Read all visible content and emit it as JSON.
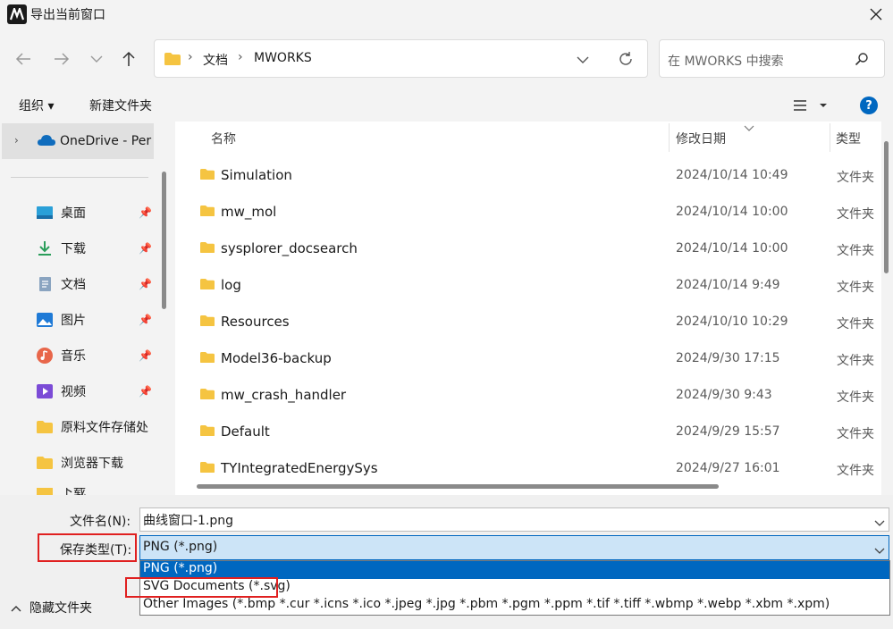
{
  "window": {
    "title": "导出当前窗口"
  },
  "address": {
    "crumbs": [
      "文档",
      "MWORKS"
    ]
  },
  "search": {
    "placeholder": "在 MWORKS 中搜索"
  },
  "toolbar": {
    "organize": "组织 ▾",
    "new_folder": "新建文件夹"
  },
  "sidebar": {
    "onedrive": "OneDrive - Per",
    "items": [
      {
        "label": "桌面",
        "icon": "desktop-icon",
        "pinned": true
      },
      {
        "label": "下载",
        "icon": "download-icon",
        "pinned": true
      },
      {
        "label": "文档",
        "icon": "document-icon",
        "pinned": true
      },
      {
        "label": "图片",
        "icon": "picture-icon",
        "pinned": true
      },
      {
        "label": "音乐",
        "icon": "music-icon",
        "pinned": true
      },
      {
        "label": "视频",
        "icon": "video-icon",
        "pinned": true
      },
      {
        "label": "原料文件存储处",
        "icon": "folder-icon",
        "pinned": false
      },
      {
        "label": "浏览器下载",
        "icon": "folder-icon",
        "pinned": false
      },
      {
        "label": "下载",
        "icon": "folder-icon",
        "pinned": false
      }
    ]
  },
  "columns": {
    "name": "名称",
    "date": "修改日期",
    "type": "类型"
  },
  "files": [
    {
      "name": "Simulation",
      "date": "2024/10/14 10:49",
      "type": "文件夹"
    },
    {
      "name": "mw_mol",
      "date": "2024/10/14 10:00",
      "type": "文件夹"
    },
    {
      "name": "sysplorer_docsearch",
      "date": "2024/10/14 10:00",
      "type": "文件夹"
    },
    {
      "name": "log",
      "date": "2024/10/14 9:49",
      "type": "文件夹"
    },
    {
      "name": "Resources",
      "date": "2024/10/10 10:29",
      "type": "文件夹"
    },
    {
      "name": "Model36-backup",
      "date": "2024/9/30 17:15",
      "type": "文件夹"
    },
    {
      "name": "mw_crash_handler",
      "date": "2024/9/30 9:43",
      "type": "文件夹"
    },
    {
      "name": "Default",
      "date": "2024/9/29 15:57",
      "type": "文件夹"
    },
    {
      "name": "TYIntegratedEnergySys",
      "date": "2024/9/27 16:01",
      "type": "文件夹"
    }
  ],
  "form": {
    "filename_label": "文件名(N):",
    "filename_value": "曲线窗口-1.png",
    "filetype_label": "保存类型(T):",
    "filetype_value": "PNG (*.png)",
    "options": [
      "PNG (*.png)",
      "SVG Documents (*.svg)",
      "Other Images (*.bmp *.cur *.icns *.ico *.jpeg *.jpg *.pbm *.pgm *.ppm *.tif *.tiff *.wbmp *.webp *.xbm *.xpm)"
    ],
    "hide_folders": "隐藏文件夹"
  },
  "colors": {
    "accent": "#0067c0",
    "folder": "#f5c441",
    "selection": "#cce4f7",
    "highlight_box": "#e02020"
  }
}
